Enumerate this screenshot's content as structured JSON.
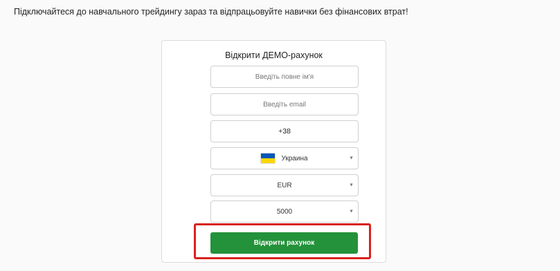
{
  "intro": {
    "text": "Підключайтеся до навчального трейдингу зараз та відпрацьовуйте навички без фінансових втрат!"
  },
  "form": {
    "title": "Відкрити ДЕМО-рахунок",
    "name_placeholder": "Введіть повне ім'я",
    "email_placeholder": "Введіть email",
    "phone_value": "+38",
    "country": {
      "selected": "Украина",
      "flag_colors": [
        "#0057b7",
        "#ffd700"
      ]
    },
    "currency": {
      "selected": "EUR"
    },
    "deposit": {
      "selected": "5000"
    },
    "submit_label": "Відкрити рахунок"
  },
  "colors": {
    "submit_bg": "#23923a",
    "highlight_outline": "#d9211d"
  },
  "icons": {
    "caret": "caret-down-icon",
    "flag": "ukraine-flag-icon"
  }
}
